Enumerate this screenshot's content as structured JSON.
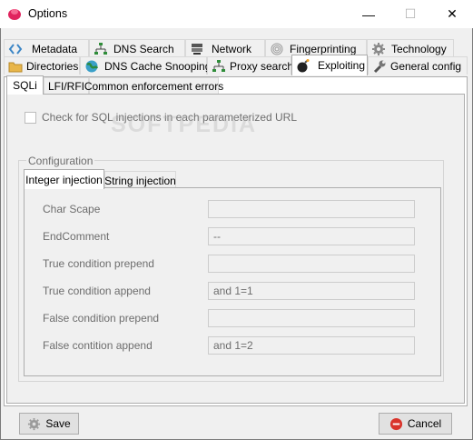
{
  "window": {
    "title": "Options",
    "controls": {
      "minimize": "—",
      "maximize": "☐",
      "close": "✕"
    }
  },
  "tabs_row1": [
    {
      "label": "Metadata",
      "icon": "code-icon"
    },
    {
      "label": "DNS Search",
      "icon": "network-tree-icon"
    },
    {
      "label": "Network",
      "icon": "server-icon"
    },
    {
      "label": "Fingerprinting",
      "icon": "fingerprint-icon"
    },
    {
      "label": "Technology",
      "icon": "gear-icon"
    }
  ],
  "tabs_row2": [
    {
      "label": "Directories",
      "icon": "folder-icon"
    },
    {
      "label": "DNS Cache Snooping",
      "icon": "globe-icon"
    },
    {
      "label": "Proxy search",
      "icon": "network-tree-icon"
    },
    {
      "label": "Exploiting",
      "icon": "bomb-icon",
      "selected": true
    },
    {
      "label": "General config",
      "icon": "wrench-icon"
    }
  ],
  "subtabs": [
    {
      "label": "SQLi",
      "selected": true
    },
    {
      "label": "LFI/RFI"
    },
    {
      "label": "Common enforcement errors"
    }
  ],
  "sqli": {
    "checkbox_label": "Check for SQL injections in each parameterized URL",
    "checked": false,
    "watermark": "SOFTPEDIA",
    "group_label": "Configuration",
    "inner_tabs": [
      {
        "label": "Integer injection",
        "selected": true
      },
      {
        "label": "String injection"
      }
    ],
    "fields": [
      {
        "label": "Char Scape",
        "value": ""
      },
      {
        "label": "EndComment",
        "value": "--"
      },
      {
        "label": "True condition prepend",
        "value": ""
      },
      {
        "label": "True condition append",
        "value": "and 1=1"
      },
      {
        "label": "False condition prepend",
        "value": ""
      },
      {
        "label": "False contition append",
        "value": "and 1=2"
      }
    ]
  },
  "buttons": {
    "save": "Save",
    "cancel": "Cancel"
  },
  "colors": {
    "window_bg": "#f0f0f0",
    "cancel_icon": "#d9342b",
    "disabled_text": "#6d6d6d"
  }
}
